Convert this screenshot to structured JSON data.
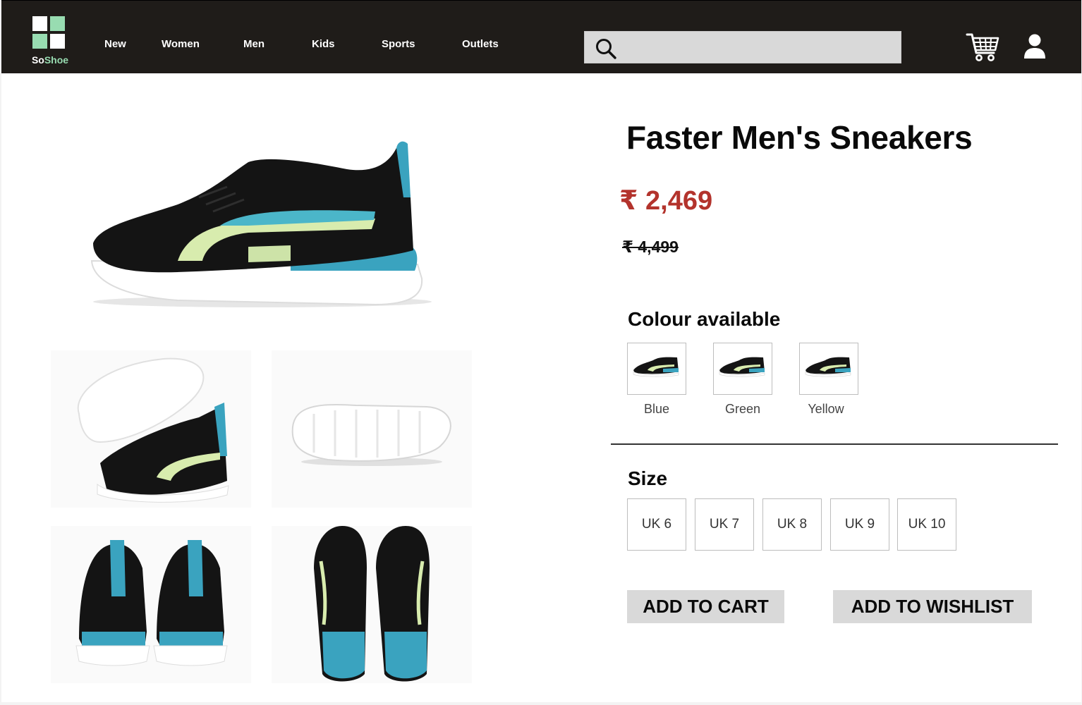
{
  "brand": {
    "name_part1": "So",
    "name_part2": "Shoe",
    "accent_color": "#98dcb1"
  },
  "nav": {
    "items": [
      {
        "label": "New"
      },
      {
        "label": "Women"
      },
      {
        "label": "Men"
      },
      {
        "label": "Kids"
      },
      {
        "label": "Sports"
      },
      {
        "label": "Outlets"
      }
    ]
  },
  "search": {
    "value": "",
    "placeholder": "",
    "icon": "search-icon"
  },
  "header_icons": {
    "cart": "cart-icon",
    "user": "user-icon"
  },
  "product": {
    "title": "Faster Men's Sneakers",
    "price": "₹ 2,469",
    "price_color": "#b3332c",
    "mrp": "₹ 4,499"
  },
  "colours": {
    "heading": "Colour available",
    "options": [
      {
        "label": "Blue"
      },
      {
        "label": "Green"
      },
      {
        "label": "Yellow"
      }
    ]
  },
  "sizes": {
    "heading": "Size",
    "options": [
      "UK 6",
      "UK 7",
      "UK 8",
      "UK 9",
      "UK 10"
    ]
  },
  "actions": {
    "add_to_cart": "ADD TO CART",
    "add_to_wishlist": "ADD TO WISHLIST"
  }
}
